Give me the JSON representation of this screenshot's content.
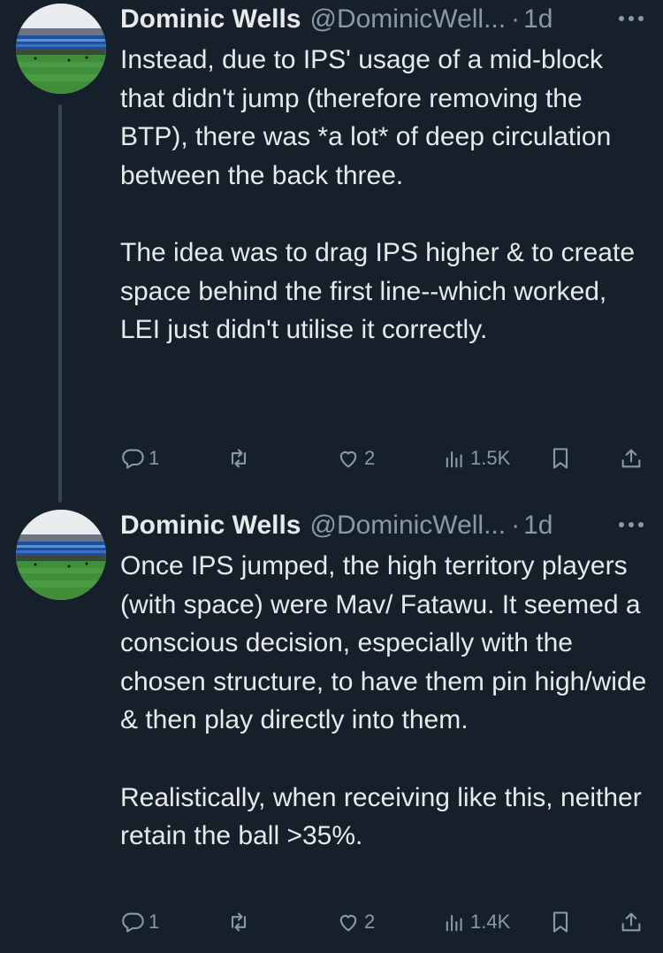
{
  "tweets": [
    {
      "author": {
        "name": "Dominic Wells",
        "handle": "@DominicWell...",
        "avatar_icon": "stadium-avatar"
      },
      "separator": "·",
      "time": "1d",
      "paragraphs": [
        "Instead, due to IPS' usage of a mid-block that didn't jump (therefore removing the BTP), there was *a lot* of deep circulation between the back three.",
        "The idea was to drag IPS higher & to create space behind the first line--which worked, LEI just didn't utilise it correctly."
      ],
      "stats": {
        "replies": "1",
        "retweets": "",
        "likes": "2",
        "views": "1.5K"
      }
    },
    {
      "author": {
        "name": "Dominic Wells",
        "handle": "@DominicWell...",
        "avatar_icon": "stadium-avatar"
      },
      "separator": "·",
      "time": "1d",
      "paragraphs": [
        "Once IPS jumped, the high territory players (with space) were Mav/ Fatawu. It seemed a conscious decision, especially with the chosen structure, to have them pin high/wide & then play directly into them.",
        "Realistically, when receiving like this, neither retain the ball >35%."
      ],
      "stats": {
        "replies": "1",
        "retweets": "",
        "likes": "2",
        "views": "1.4K"
      }
    }
  ],
  "colors": {
    "background": "#15202b",
    "text": "#e7e9ea",
    "secondary": "#8b98a5",
    "thread_line": "#38444d"
  },
  "icons": [
    "more-icon",
    "reply-icon",
    "retweet-icon",
    "like-icon",
    "views-icon",
    "bookmark-icon",
    "share-icon"
  ]
}
